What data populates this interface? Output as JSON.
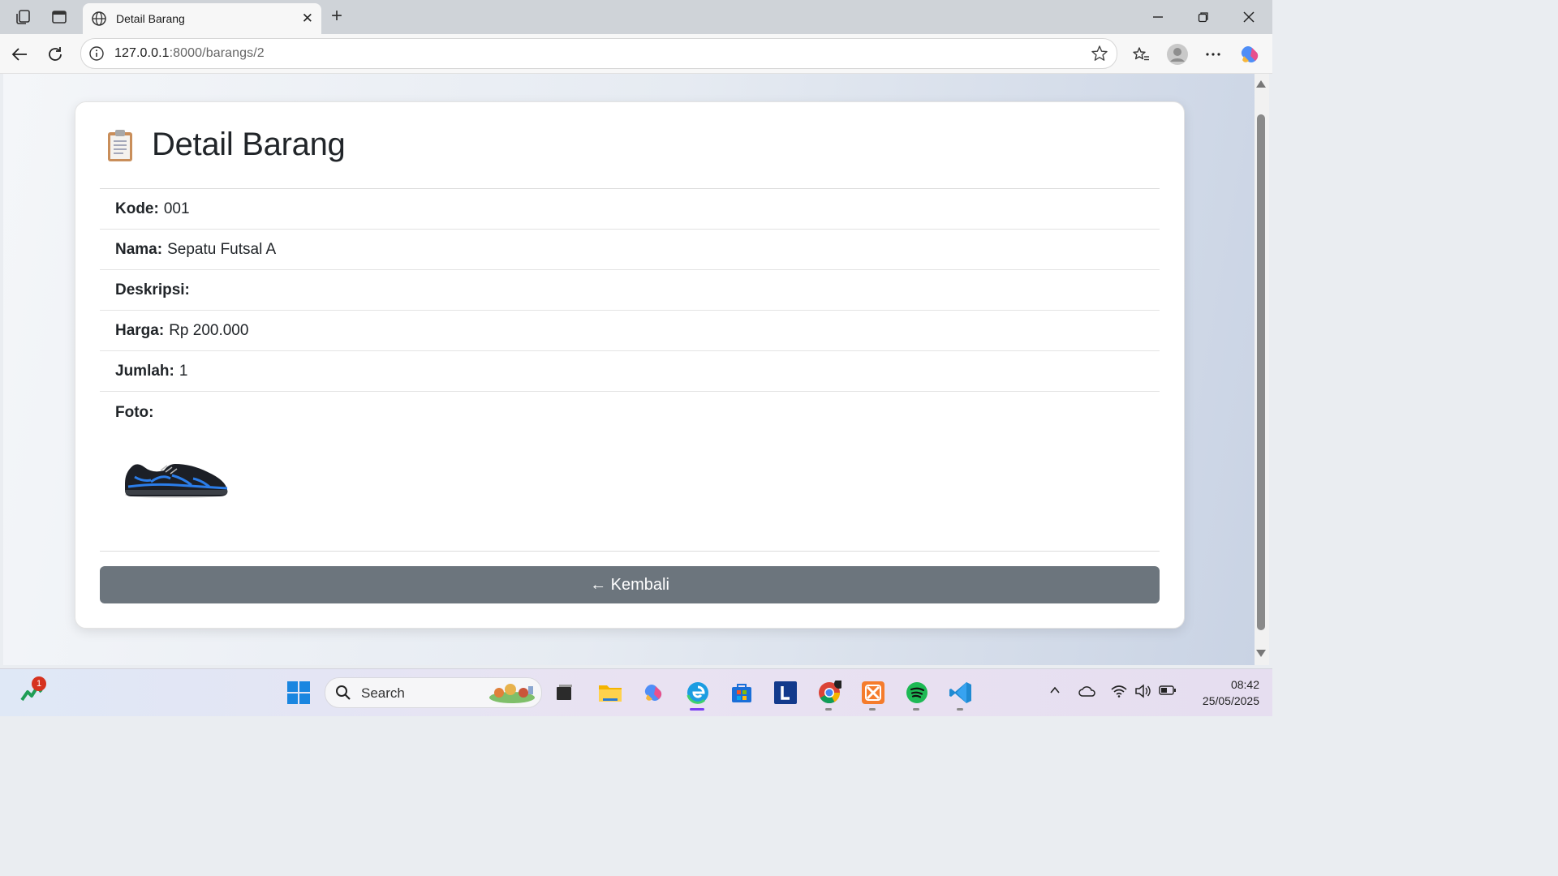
{
  "browser": {
    "tab_title": "Detail Barang",
    "url_host": "127.0.0.1",
    "url_path": ":8000/barangs/2"
  },
  "page": {
    "heading": "Detail Barang",
    "heading_icon": "clipboard-icon",
    "fields": [
      {
        "label": "Kode:",
        "value": "001"
      },
      {
        "label": "Nama:",
        "value": "Sepatu Futsal A"
      },
      {
        "label": "Deskripsi:",
        "value": ""
      },
      {
        "label": "Harga:",
        "value": "Rp 200.000"
      },
      {
        "label": "Jumlah:",
        "value": "1"
      },
      {
        "label": "Foto:",
        "value": ""
      }
    ],
    "photo_alt": "shoe-photo",
    "back_button": "← Kembali",
    "back_button_color": "#6c757d"
  },
  "taskbar": {
    "search_placeholder": "Search",
    "notification_count": "1",
    "time": "08:42",
    "date": "25/05/2025",
    "accent_color": "#7b3ff2"
  }
}
